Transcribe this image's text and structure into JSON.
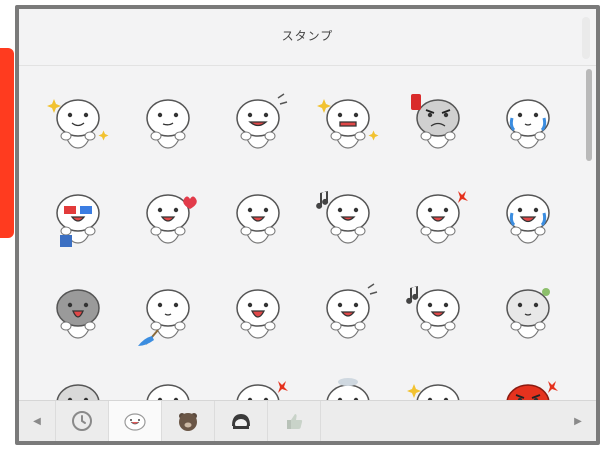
{
  "panel": {
    "title": "スタンプ"
  },
  "stickers": [
    {
      "icon": "moon-praying-sticker-icon"
    },
    {
      "icon": "moon-smirk-sticker-icon"
    },
    {
      "icon": "moon-grin-sticker-icon"
    },
    {
      "icon": "moon-gritted-teeth-sticker-icon"
    },
    {
      "icon": "moon-angry-exclamation-sticker-icon"
    },
    {
      "icon": "moon-thumbs-hold-sticker-icon"
    },
    {
      "icon": "moon-3d-glasses-popcorn-sticker-icon"
    },
    {
      "icon": "moon-love-hearts-sticker-icon"
    },
    {
      "icon": "moon-happy-wave-sticker-icon"
    },
    {
      "icon": "moon-drooling-sticker-icon"
    },
    {
      "icon": "moon-crying-anger-sticker-icon"
    },
    {
      "icon": "moon-sobbing-sticker-icon"
    },
    {
      "icon": "moon-scream-sticker-icon"
    },
    {
      "icon": "moon-sweeping-sticker-icon"
    },
    {
      "icon": "moon-yawn-sticker-icon"
    },
    {
      "icon": "moon-shocked-sticker-icon"
    },
    {
      "icon": "moon-singing-sticker-icon"
    },
    {
      "icon": "moon-thumbs-up-sticker-icon"
    },
    {
      "icon": "moon-lying-down-sticker-icon"
    },
    {
      "icon": "moon-laughing-tears-sticker-icon"
    },
    {
      "icon": "moon-dizzy-sticker-icon"
    },
    {
      "icon": "moon-sad-sticker-icon"
    },
    {
      "icon": "moon-tearful-cheer-sticker-icon"
    },
    {
      "icon": "moon-red-angry-sticker-icon"
    }
  ],
  "footer": {
    "tabs": [
      {
        "icon": "clock-recent-icon",
        "active": false
      },
      {
        "icon": "moon-sticker-tab-icon",
        "active": true
      },
      {
        "icon": "brown-bear-tab-icon",
        "active": false
      },
      {
        "icon": "cony-girl-tab-icon",
        "active": false
      },
      {
        "icon": "thumbs-up-tab-icon",
        "active": false
      }
    ],
    "left_arrow": "◀",
    "right_arrow": "▶"
  },
  "colors": {
    "accent": "#ff3b1f",
    "panel_border": "#7a7a7a",
    "panel_bg": "#f3f3f4"
  }
}
